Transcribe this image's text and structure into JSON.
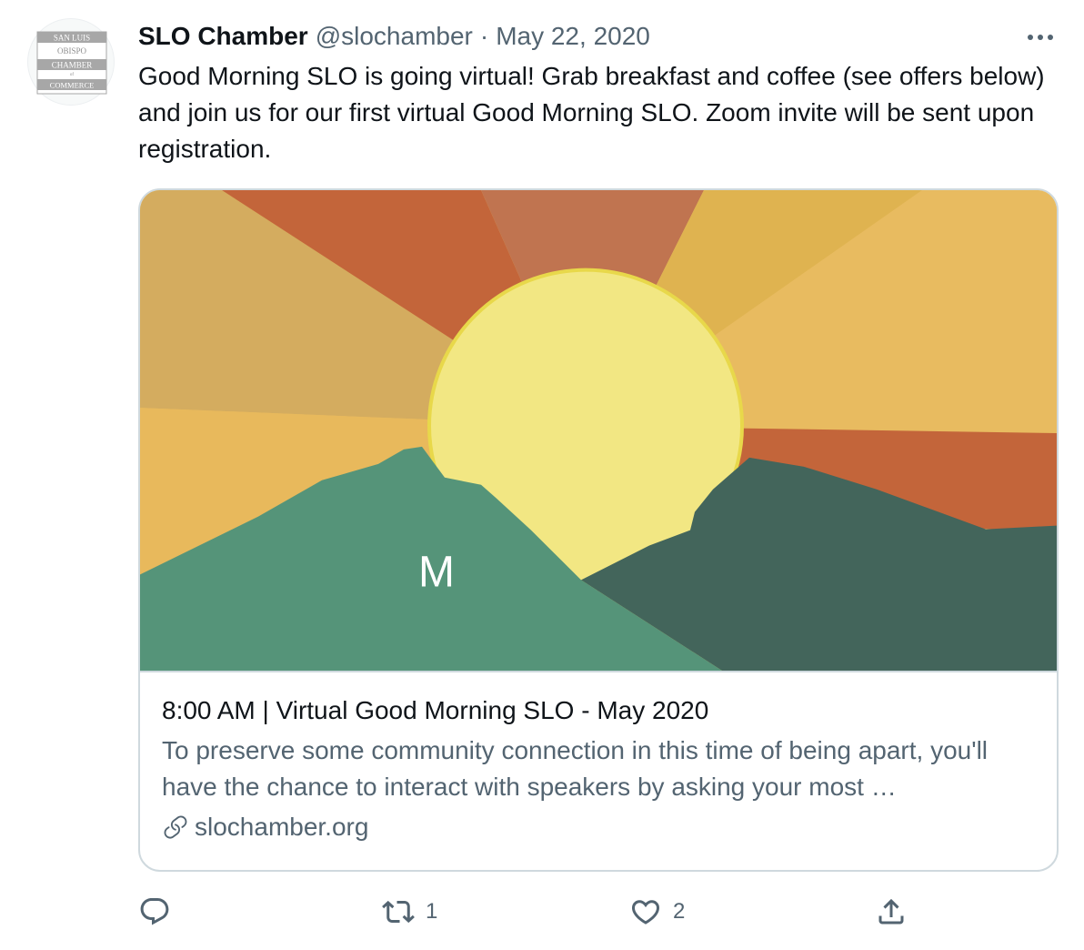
{
  "avatar": {
    "lines": [
      "SAN LUIS",
      "OBISPO",
      "CHAMBER",
      "of",
      "COMMERCE"
    ]
  },
  "tweet": {
    "author_name": "SLO Chamber",
    "handle": "@slochamber",
    "separator": "·",
    "date": "May 22, 2020",
    "text": "Good Morning SLO is going virtual! Grab breakfast and coffee (see offers below) and join us for our first virtual Good Morning SLO. Zoom invite will be sent upon registration.",
    "more_icon": "more-icon"
  },
  "card": {
    "image_letter": "M",
    "title": "8:00 AM | Virtual Good Morning SLO - May 2020",
    "description": "To preserve some community connection in this time of being apart, you'll have the chance to interact with speakers by asking your most …",
    "link": "slochamber.org",
    "colors": {
      "sun": "#f2e783",
      "mountain_light": "#559479",
      "mountain_dark": "#43655b",
      "ray_orange": "#c3653a",
      "ray_yellow": "#e8bb60"
    }
  },
  "actions": {
    "reply_icon": "reply-icon",
    "retweet_icon": "retweet-icon",
    "retweet_count": "1",
    "like_icon": "heart-icon",
    "like_count": "2",
    "share_icon": "share-icon"
  }
}
